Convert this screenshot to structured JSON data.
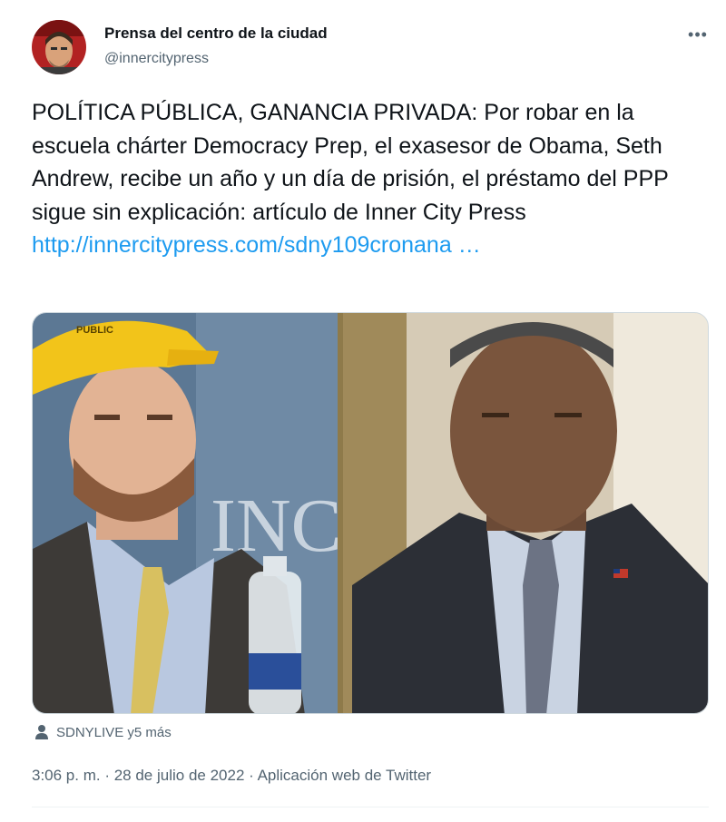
{
  "author": {
    "display_name": "Prensa del centro de la ciudad",
    "handle": "@innercitypress"
  },
  "more_icon": "more-horizontal-icon",
  "tweet": {
    "text": "POLÍTICA PÚBLICA, GANANCIA PRIVADA: Por robar en la escuela chárter Democracy Prep, el exasesor de Obama, Seth Andrew, recibe un año y un día de prisión, el préstamo del PPP sigue sin explicación: artículo de Inner City Press",
    "link": "http://innercitypress.com/sdny109cronana …"
  },
  "media": {
    "left_photo_caption": "PUBLIC",
    "backdrop_text": "INC"
  },
  "tagged": {
    "icon": "person-icon",
    "text": "SDNYLIVE y5 más"
  },
  "meta": {
    "time": "3:06 p. m.",
    "separator": " · ",
    "date": "28 de julio de 2022",
    "separator2": " · ",
    "source": "Aplicación web de Twitter"
  },
  "colors": {
    "link": "#1d9bf0",
    "secondary_text": "#536471",
    "primary_text": "#0f1419"
  }
}
